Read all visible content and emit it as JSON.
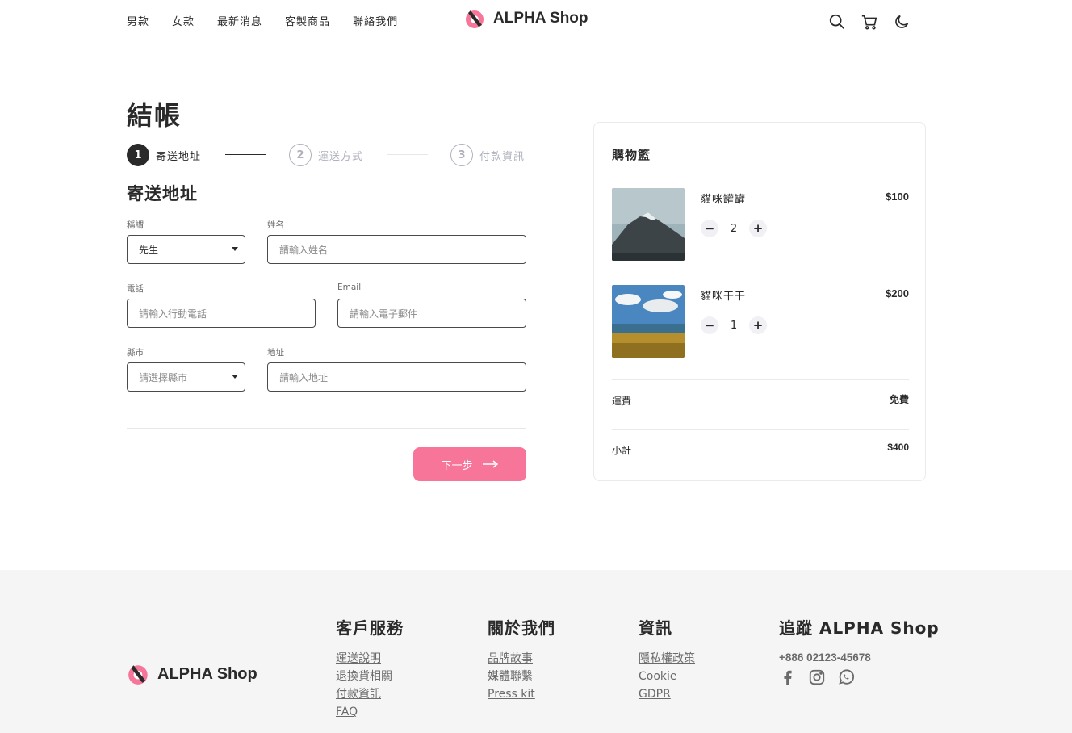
{
  "header": {
    "nav": [
      "男款",
      "女款",
      "最新消息",
      "客製商品",
      "聯絡我們"
    ],
    "brand": "ALPHA Shop",
    "icons": [
      "search-icon",
      "cart-icon",
      "moon-icon"
    ]
  },
  "checkout": {
    "title": "結帳",
    "steps": [
      {
        "num": "1",
        "label": "寄送地址",
        "state": "active"
      },
      {
        "num": "2",
        "label": "運送方式",
        "state": "inactive"
      },
      {
        "num": "3",
        "label": "付款資訊",
        "state": "inactive"
      }
    ],
    "form_title": "寄送地址",
    "fields": {
      "salutation": {
        "label": "稱謂",
        "value": "先生"
      },
      "name": {
        "label": "姓名",
        "placeholder": "請輸入姓名"
      },
      "phone": {
        "label": "電話",
        "placeholder": "請輸入行動電話"
      },
      "email": {
        "label": "Email",
        "placeholder": "請輸入電子郵件"
      },
      "city": {
        "label": "縣市",
        "placeholder": "請選擇縣市"
      },
      "address": {
        "label": "地址",
        "placeholder": "請輸入地址"
      }
    },
    "next_label": "下一步",
    "accent_color": "#f67599"
  },
  "cart": {
    "title": "購物籃",
    "items": [
      {
        "name": "貓咪罐罐",
        "price": "$100",
        "qty": "2"
      },
      {
        "name": "貓咪干干",
        "price": "$200",
        "qty": "1"
      }
    ],
    "shipping_label": "運費",
    "shipping_value": "免費",
    "subtotal_label": "小計",
    "subtotal_value": "$400"
  },
  "footer": {
    "brand": "ALPHA Shop",
    "columns": [
      {
        "title": "客戶服務",
        "links": [
          "運送說明",
          "退換貨相關",
          "付款資訊",
          "FAQ"
        ]
      },
      {
        "title": "關於我們",
        "links": [
          "品牌故事",
          "媒體聯繫",
          "Press kit"
        ]
      },
      {
        "title": "資訊",
        "links": [
          "隱私權政策",
          "Cookie",
          "GDPR"
        ]
      }
    ],
    "follow_title": "追蹤 ALPHA Shop",
    "phone": "+886 02123-45678",
    "social_icons": [
      "facebook-icon",
      "instagram-icon",
      "whatsapp-icon"
    ]
  }
}
